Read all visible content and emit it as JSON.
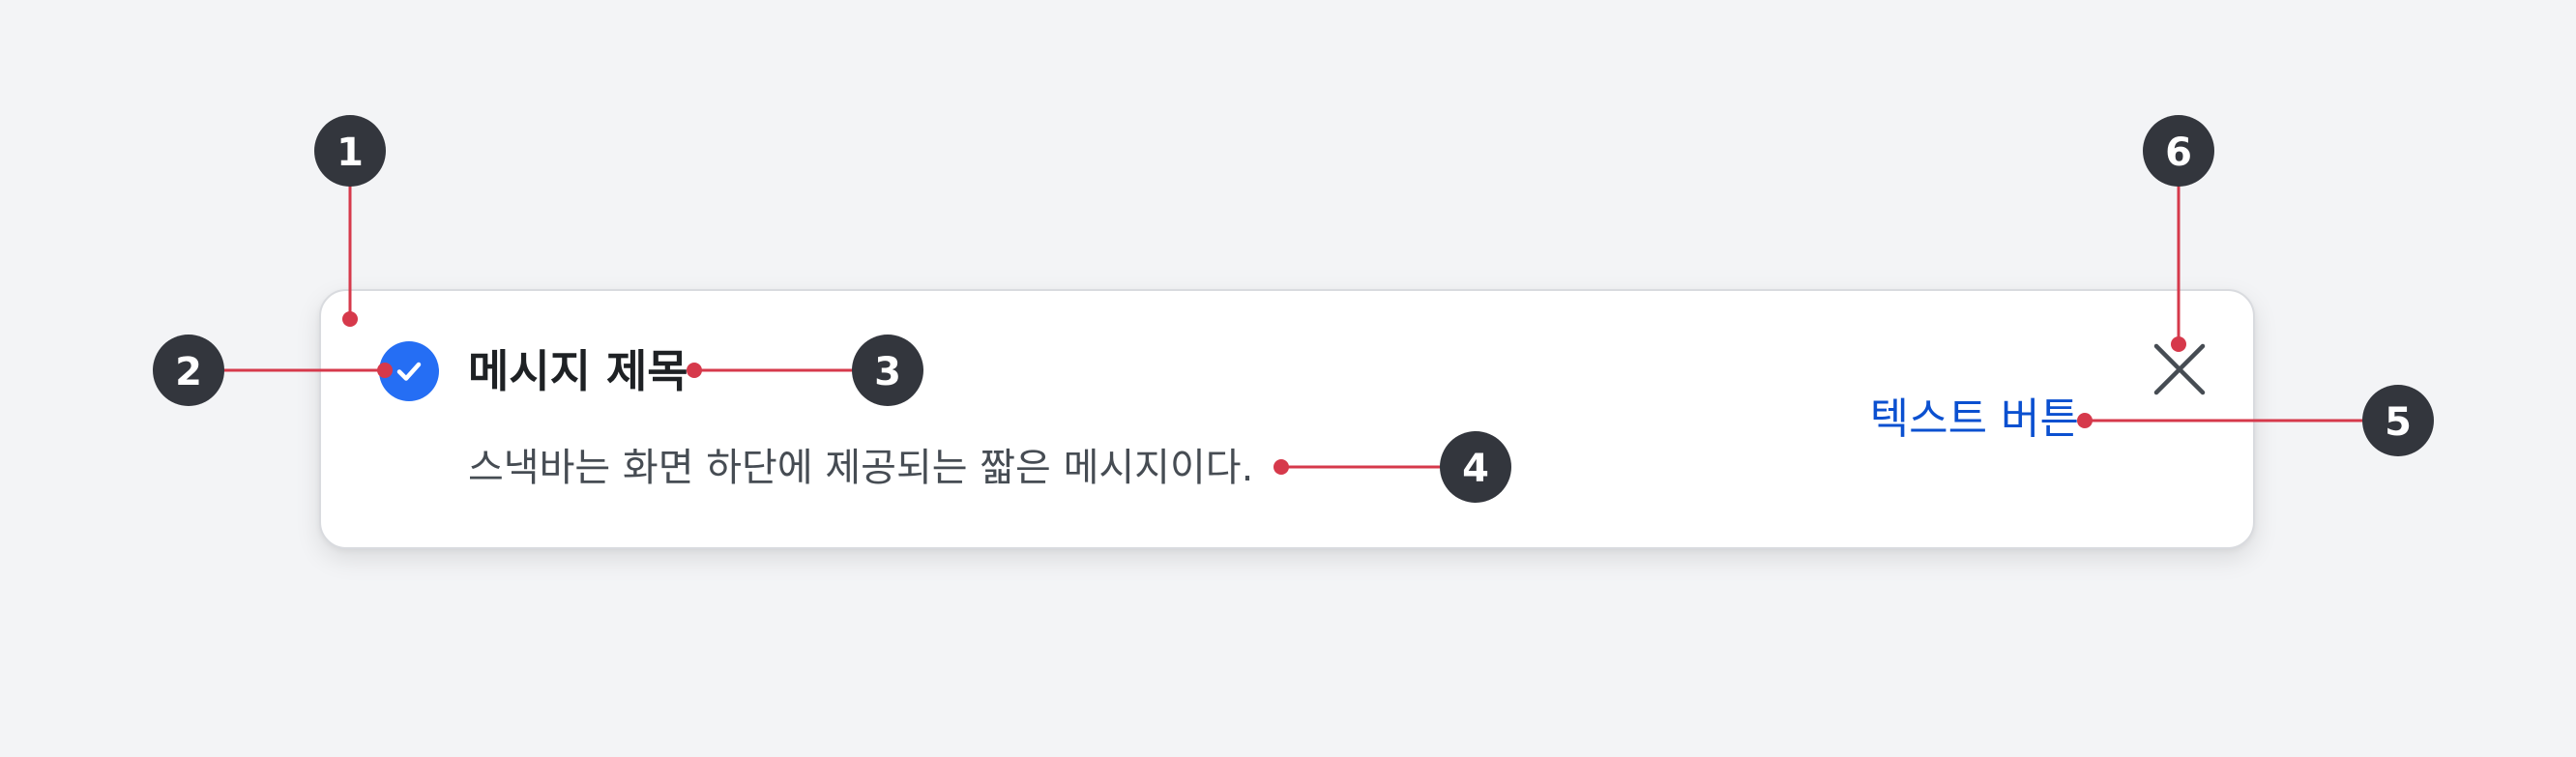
{
  "snackbar": {
    "title": "메시지 제목",
    "message": "스낵바는 화면 하단에 제공되는 짧은 메시지이다.",
    "action_label": "텍스트 버튼",
    "status_icon": "check-circle-icon",
    "close_icon": "close-icon"
  },
  "callouts": [
    "1",
    "2",
    "3",
    "4",
    "5",
    "6"
  ],
  "colors": {
    "page_background": "#f3f4f6",
    "surface": "#ffffff",
    "status_icon": "#256ef4",
    "action_text": "#0b50d0",
    "callout_badge": "#33363d",
    "leader_line": "#d6394b"
  }
}
